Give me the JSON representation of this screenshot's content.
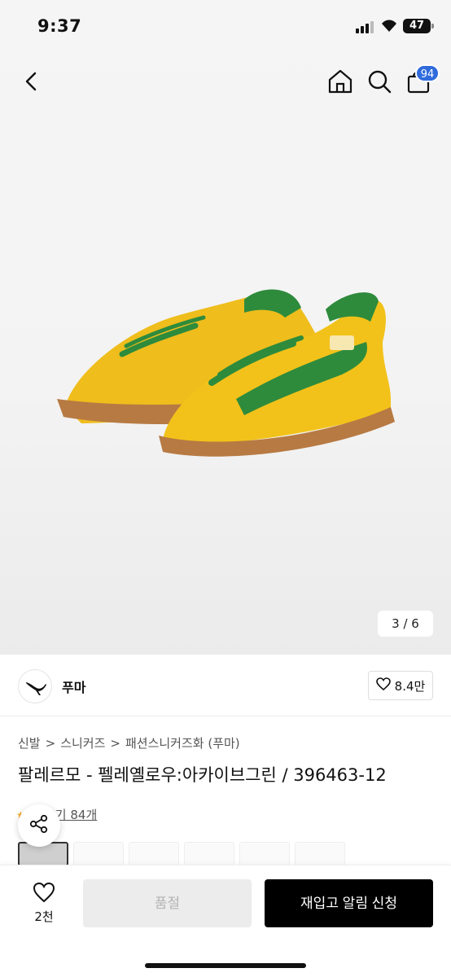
{
  "status_bar": {
    "time": "9:37",
    "battery": "47"
  },
  "nav": {
    "cart_badge": "94"
  },
  "gallery": {
    "counter": "3 / 6"
  },
  "brand": {
    "name": "푸마",
    "likes": "8.4만"
  },
  "breadcrumb": [
    "신발",
    ">",
    "스니커즈",
    ">",
    "패션스니커즈화 (푸마)"
  ],
  "product": {
    "title": "팔레르모 - 펠레옐로우:아카이브그린 / 396463-12"
  },
  "review": {
    "label": "후기 84개"
  },
  "bottom_bar": {
    "wish_count": "2천",
    "soldout_label": "품절",
    "restock_label": "재입고 알림 신청"
  },
  "colors": {
    "accent": "#2f6bdc",
    "primary_button": "#000000",
    "disabled_button": "#ececec",
    "shoe_yellow": "#f2c21a",
    "shoe_green": "#2e8b3c",
    "sole_gum": "#b77a43"
  },
  "icons": [
    "back-icon",
    "home-icon",
    "search-icon",
    "cart-icon",
    "heart-icon",
    "share-icon",
    "puma-logo-icon"
  ]
}
